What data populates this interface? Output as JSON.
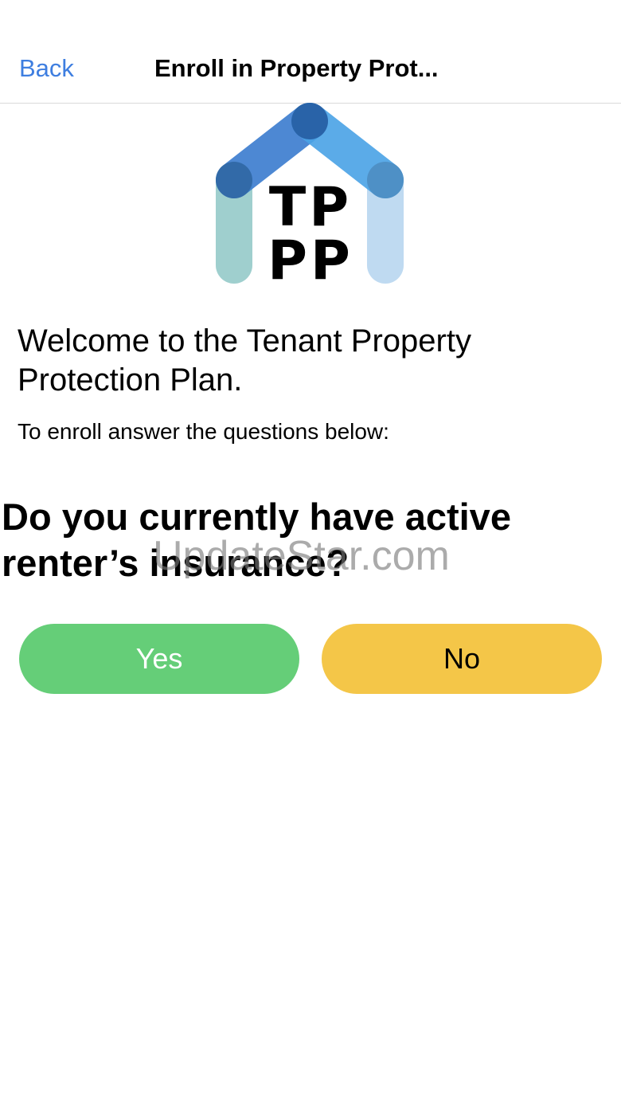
{
  "nav": {
    "back_label": "Back",
    "title": "Enroll in Property Prot..."
  },
  "logo": {
    "text_line1": "TP",
    "text_line2": "PP",
    "colors": {
      "roof_left": "#3a7ccf",
      "roof_right": "#4aa3e6",
      "roof_knot": "#1f4f94",
      "wall_left": "#8fc7c6",
      "wall_right": "#b9d7f0",
      "letters": "#000000"
    }
  },
  "main": {
    "welcome": "Welcome to the Tenant Property Protection Plan.",
    "instructions": "To enroll answer the questions below:",
    "question": "Do you currently have active renter’s insurance?",
    "watermark": "UpdateStar.com"
  },
  "buttons": {
    "yes_label": "Yes",
    "no_label": "No",
    "yes_color": "#65ce78",
    "no_color": "#f4c648"
  }
}
